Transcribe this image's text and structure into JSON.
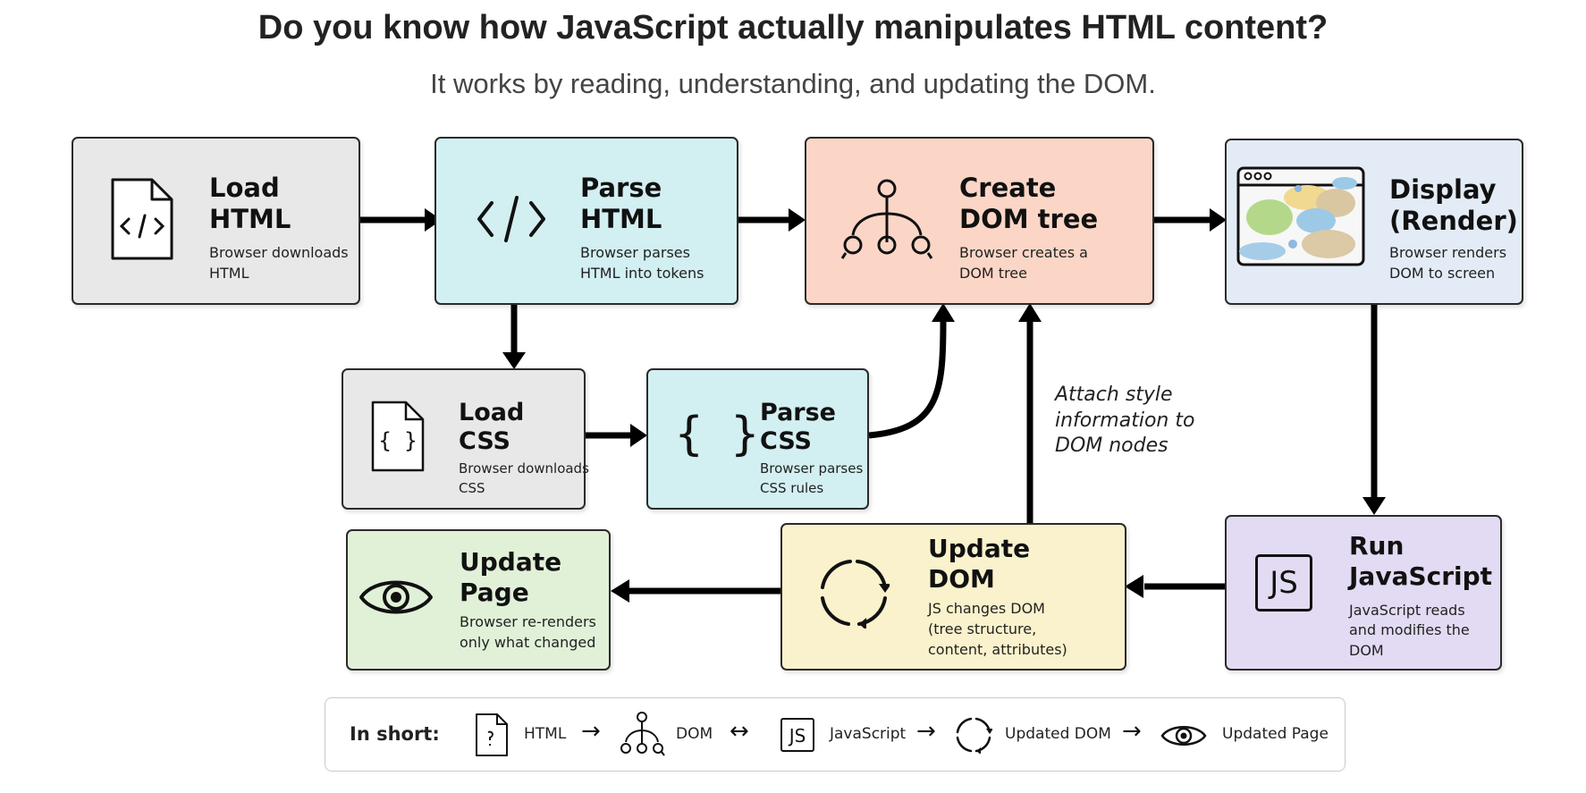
{
  "header": {
    "title": "Do you know how JavaScript actually manipulates HTML content?",
    "subtitle": "It works by reading, understanding, and updating the DOM."
  },
  "steps": {
    "load_html": {
      "title_line1": "Load",
      "title_line2": "HTML",
      "desc_line1": "Browser downloads",
      "desc_line2": "HTML",
      "color": "#e8e8e8"
    },
    "parse_html": {
      "title_line1": "Parse",
      "title_line2": "HTML",
      "desc_line1": "Browser parses",
      "desc_line2": "HTML into tokens",
      "color": "#d2eff1"
    },
    "create_dom": {
      "title_line1": "Create",
      "title_line2": "DOM tree",
      "desc_line1": "Browser creates a",
      "desc_line2": "DOM tree",
      "color": "#fbd6c6"
    },
    "display": {
      "title_line1": "Display",
      "title_line2": "(Render)",
      "desc_line1": "Browser renders",
      "desc_line2": "DOM to screen",
      "color": "#e3ecf6"
    },
    "load_css": {
      "title_line1": "Load",
      "title_line2": "CSS",
      "desc_line1": "Browser downloads",
      "desc_line2": "CSS",
      "color": "#e8e8e8"
    },
    "parse_css": {
      "title_line1": "Parse",
      "title_line2": "CSS",
      "desc_line1": "Browser parses",
      "desc_line2": "CSS rules",
      "color": "#d2eff1"
    },
    "update_page": {
      "title_line1": "Update",
      "title_line2": "Page",
      "desc_line1": "Browser re-renders",
      "desc_line2": "only what changed",
      "color": "#e1f1d8"
    },
    "update_dom": {
      "title_line1": "Update",
      "title_line2": "DOM",
      "desc_line1": "JS changes DOM",
      "desc_line2": "(tree structure,",
      "desc_line3": "content, attributes)",
      "color": "#faf2cc"
    },
    "run_js": {
      "title_line1": "Run",
      "title_line2": "JavaScript",
      "desc_line1": "JavaScript reads",
      "desc_line2": "and modifies the",
      "desc_line3": "DOM",
      "color": "#e3dbf3"
    }
  },
  "edge_note": {
    "line1": "Attach style",
    "line2": "information to",
    "line3": "DOM nodes"
  },
  "summary": {
    "label": "In short:",
    "items": [
      "HTML",
      "DOM",
      "JavaScript",
      "Updated DOM",
      "Updated Page"
    ],
    "arrows": [
      "→",
      "↔",
      "→",
      "→"
    ],
    "js_badge": "JS"
  },
  "icons": {
    "load_html": "html-file-icon",
    "parse_html": "code-tag-icon",
    "create_dom": "tree-icon",
    "display": "browser-window-icon",
    "load_css": "css-file-icon",
    "parse_css": "curly-braces-icon",
    "update_page": "eye-icon",
    "update_dom": "refresh-cycle-icon",
    "run_js": "js-badge-icon"
  }
}
